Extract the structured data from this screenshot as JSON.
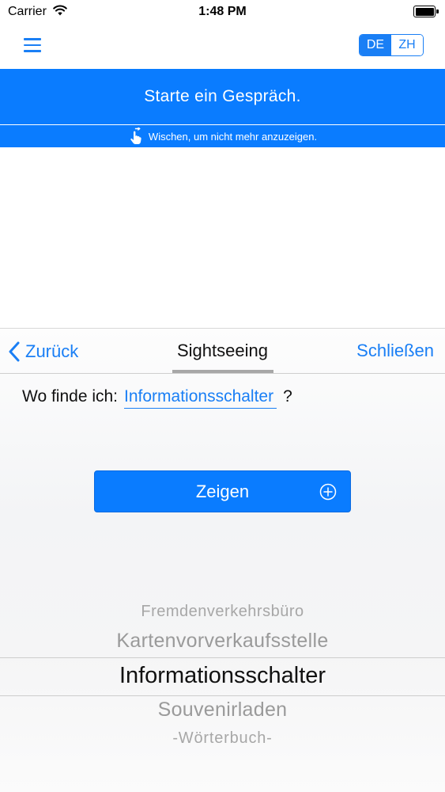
{
  "status_bar": {
    "carrier": "Carrier",
    "time": "1:48 PM"
  },
  "nav": {
    "lang_primary": "DE",
    "lang_secondary": "ZH",
    "active_lang": "DE"
  },
  "banner": {
    "title": "Starte ein Gespräch.",
    "swipe_hint": "Wischen, um nicht mehr anzuzeigen."
  },
  "panel": {
    "back_label": "Zurück",
    "title": "Sightseeing",
    "close_label": "Schließen",
    "question_prefix": "Wo finde ich:",
    "question_slot": "Informationsschalter",
    "question_suffix": "?",
    "show_button": "Zeigen"
  },
  "picker": {
    "items": [
      "Fremdenverkehrsbüro",
      "Kartenvorverkaufsstelle",
      "Informationsschalter",
      "Souvenirladen",
      "-Wörterbuch-"
    ],
    "selected": "Informationsschalter"
  },
  "colors": {
    "accent": "#1a7ff5",
    "banner": "#0a7cff"
  },
  "icons": {
    "menu": "hamburger-icon",
    "swipe": "swipe-hand-icon",
    "back": "chevron-left-icon",
    "add": "plus-circle-icon",
    "wifi": "wifi-icon",
    "battery": "battery-icon"
  }
}
